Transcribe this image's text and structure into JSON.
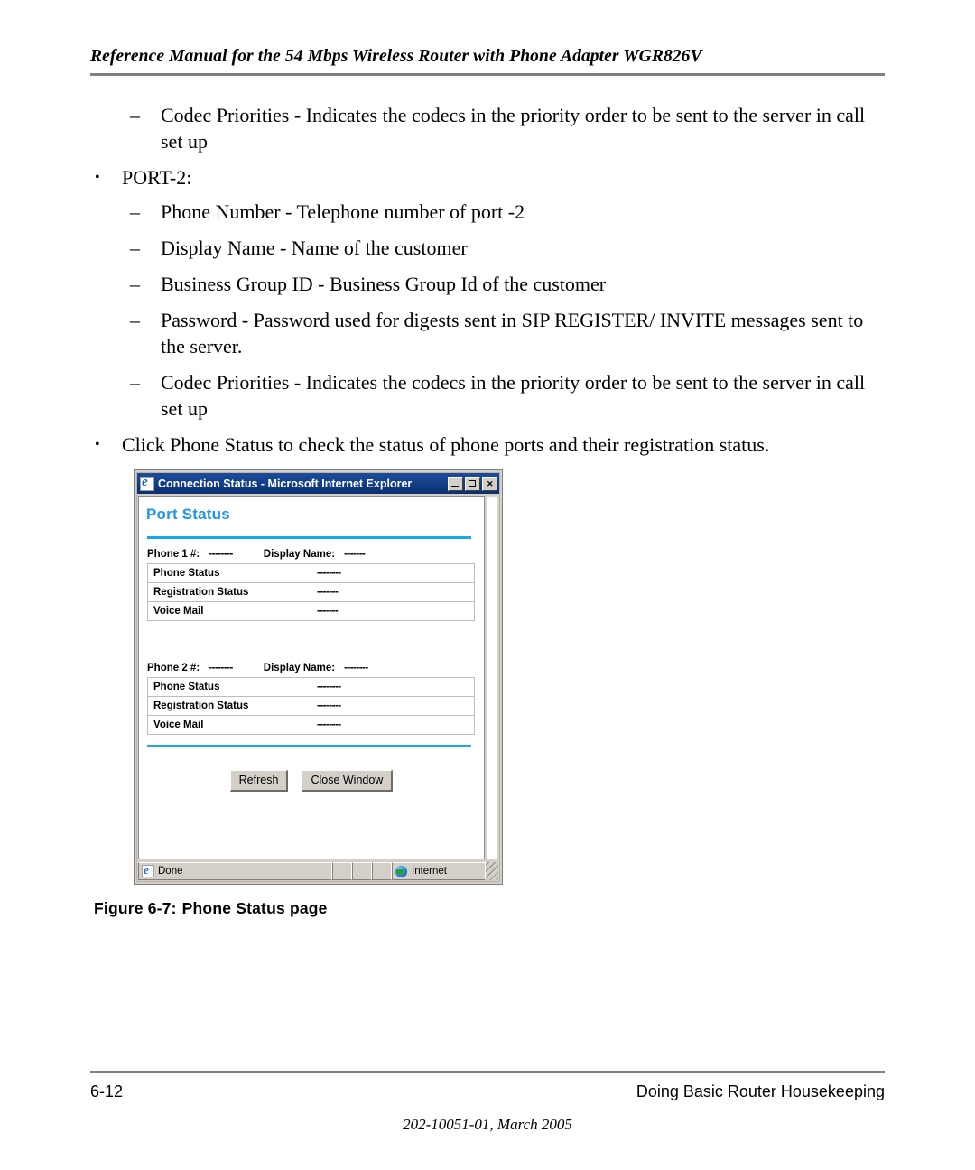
{
  "header": {
    "title": "Reference Manual for the 54 Mbps Wireless Router with Phone Adapter WGR826V"
  },
  "content": {
    "bullets": [
      {
        "level": 2,
        "marker": "–",
        "text": "Codec Priorities - Indicates the codecs in the priority order to be sent to the server in call set up"
      },
      {
        "level": 1,
        "marker": "•",
        "text": "PORT-2:"
      },
      {
        "level": 2,
        "marker": "–",
        "text": "Phone Number - Telephone number of port -2"
      },
      {
        "level": 2,
        "marker": "–",
        "text": "Display Name - Name of the customer"
      },
      {
        "level": 2,
        "marker": "–",
        "text": "Business Group ID - Business Group Id of the customer"
      },
      {
        "level": 2,
        "marker": "–",
        "text": "Password - Password used for digests sent in SIP REGISTER/ INVITE messages sent to the server."
      },
      {
        "level": 2,
        "marker": "–",
        "text": "Codec Priorities - Indicates the codecs in the priority order to be sent to the server in call set up"
      },
      {
        "level": 1,
        "marker": "•",
        "text": "Click Phone Status to check the status of phone ports and their registration status."
      }
    ]
  },
  "browser_window": {
    "title": "Connection Status - Microsoft Internet Explorer",
    "window_buttons": {
      "minimize": "minimize-button",
      "maximize": "maximize-button",
      "close": "close-button"
    },
    "page": {
      "heading": "Port Status",
      "accent_color": "#18a9e8",
      "heading_color": "#2196e8",
      "phone_sections": [
        {
          "number_label": "Phone 1 #:",
          "number_value": "--------",
          "display_name_label": "Display Name:",
          "display_name_value": "-------",
          "rows": [
            {
              "label": "Phone Status",
              "value": "--------"
            },
            {
              "label": "Registration Status",
              "value": "-------"
            },
            {
              "label": "Voice Mail",
              "value": "-------"
            }
          ]
        },
        {
          "number_label": "Phone 2 #:",
          "number_value": "--------",
          "display_name_label": "Display Name:",
          "display_name_value": "--------",
          "rows": [
            {
              "label": "Phone Status",
              "value": "--------"
            },
            {
              "label": "Registration Status",
              "value": "--------"
            },
            {
              "label": "Voice Mail",
              "value": "--------"
            }
          ]
        }
      ],
      "buttons": {
        "refresh": "Refresh",
        "close_window": "Close Window"
      }
    },
    "statusbar": {
      "status_text": "Done",
      "zone_text": "Internet"
    }
  },
  "figure": {
    "label": "Figure 6-7:",
    "caption": "Phone Status page"
  },
  "footer": {
    "page_number": "6-12",
    "chapter_title": "Doing Basic Router Housekeeping",
    "doc_id": "202-10051-01, March 2005"
  }
}
